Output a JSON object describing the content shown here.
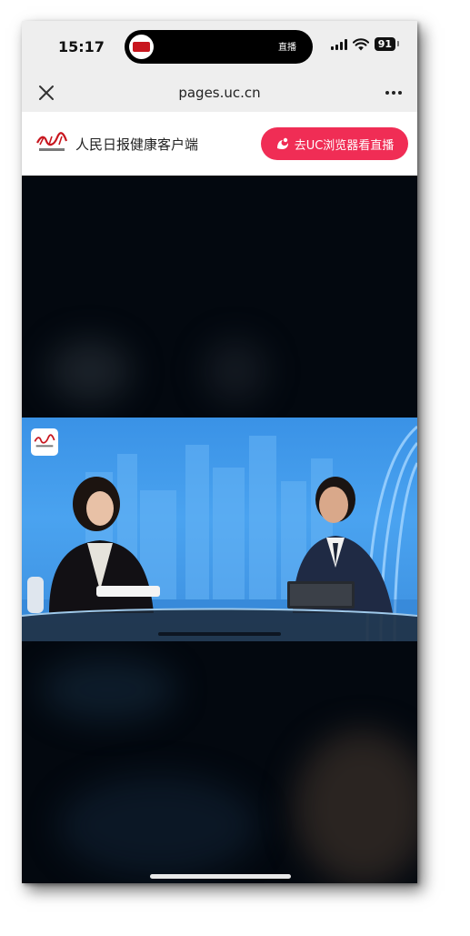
{
  "status_bar": {
    "time": "15:17",
    "live_indicator": "直播",
    "battery": "91",
    "icons": [
      "signal-icon",
      "wifi-icon",
      "battery-icon"
    ]
  },
  "browser": {
    "url": "pages.uc.cn",
    "close_icon": "close-icon",
    "more_icon": "more-icon"
  },
  "banner": {
    "app_name": "人民日报健康客户端",
    "open_button_label": "去UC浏览器看直播"
  },
  "video": {
    "watermark": "people-daily-health-logo"
  },
  "colors": {
    "accent": "#f02d55",
    "brand_red": "#c8161e",
    "chrome_bg": "#eeeeee",
    "page_bg": "#03080f",
    "studio_blue": "#3a92e6"
  }
}
